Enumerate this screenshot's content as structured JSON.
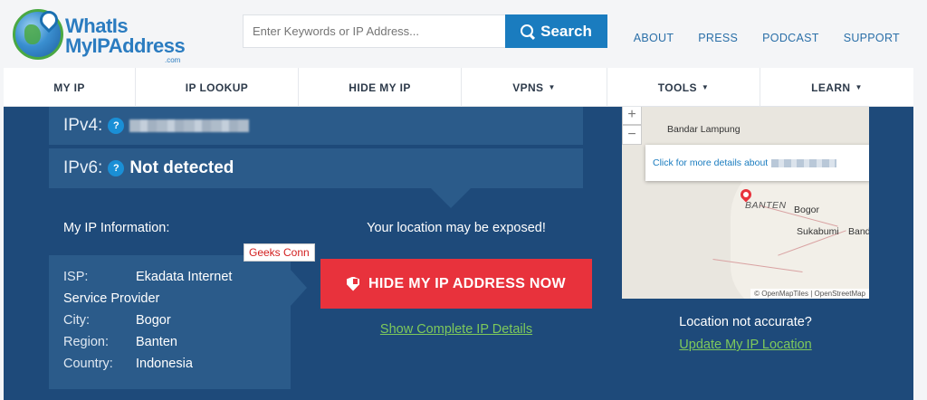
{
  "logo": {
    "line1": "WhatIs",
    "line2": "MyIPAddress",
    "line3": ".com"
  },
  "search": {
    "placeholder": "Enter Keywords or IP Address...",
    "button_label": "Search"
  },
  "top_links": [
    "ABOUT",
    "PRESS",
    "PODCAST",
    "SUPPORT"
  ],
  "nav": [
    {
      "label": "MY IP",
      "caret": ""
    },
    {
      "label": "IP LOOKUP",
      "caret": ""
    },
    {
      "label": "HIDE MY IP",
      "caret": ""
    },
    {
      "label": "VPNS",
      "caret": "▼"
    },
    {
      "label": "TOOLS",
      "caret": "▼"
    },
    {
      "label": "LEARN",
      "caret": "▼"
    }
  ],
  "ip": {
    "ipv4_label": "IPv4:",
    "ipv6_label": "IPv6:",
    "ipv6_value": "Not detected",
    "help_symbol": "?"
  },
  "info": {
    "title": "My IP Information:",
    "isp_key": "ISP:",
    "isp_value": "Ekadata Internet",
    "isp_value_wrap": "Service Provider",
    "city_key": "City:",
    "city_value": "Bogor",
    "region_key": "Region:",
    "region_value": "Banten",
    "country_key": "Country:",
    "country_value": "Indonesia"
  },
  "overlay_label": "Geeks Conn",
  "exposure": {
    "message": "Your location may be exposed!",
    "hide_button": "HIDE MY IP ADDRESS NOW",
    "details_link": "Show Complete IP Details"
  },
  "map": {
    "zoom_in": "+",
    "zoom_out": "−",
    "labels": [
      "Bandar Lampung",
      "BANTEN",
      "Bogor",
      "Sukabumi",
      "Band"
    ],
    "popup_text": "Click for more details about",
    "attribution": "© OpenMapTiles | OpenStreetMap"
  },
  "location": {
    "question": "Location not accurate?",
    "update_link": "Update My IP Location"
  },
  "colors": {
    "brand_blue": "#1a7cbf",
    "main_bg": "#1e4a7a",
    "panel_bg": "#2b5b8a",
    "cta_red": "#e8323c",
    "link_green": "#7ec95b"
  }
}
